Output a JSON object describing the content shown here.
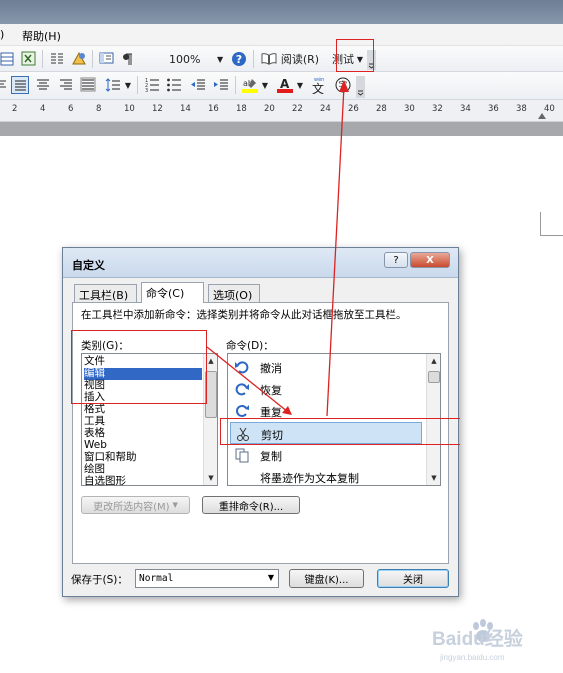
{
  "menu": {
    "paren": ")",
    "help": "帮助(H)"
  },
  "toolbar1": {
    "zoom": "100%",
    "read": "阅读(R)",
    "custom_button": "测试"
  },
  "ruler": [
    "2",
    "4",
    "6",
    "8",
    "10",
    "12",
    "14",
    "16",
    "18",
    "20",
    "22",
    "24",
    "26",
    "28",
    "30",
    "32",
    "34",
    "36",
    "38",
    "40"
  ],
  "dialog": {
    "title": "自定义",
    "help_glyph": "?",
    "close_glyph": "X",
    "tabs": [
      "工具栏(B)",
      "命令(C)",
      "选项(O)"
    ],
    "instruction": "在工具栏中添加新命令：选择类别并将命令从此对话框拖放至工具栏。",
    "categories_label": "类别(G)：",
    "categories": [
      "文件",
      "编辑",
      "视图",
      "插入",
      "格式",
      "工具",
      "表格",
      "Web",
      "窗口和帮助",
      "绘图",
      "自选图形"
    ],
    "selected_category": "编辑",
    "commands_label": "命令(D)：",
    "commands": [
      "撤消",
      "恢复",
      "重复",
      "剪切",
      "复制",
      "将墨迹作为文本复制"
    ],
    "selected_command": "剪切",
    "modify_selection": "更改所选内容(M)",
    "rearrange": "重排命令(R)...",
    "save_in_label": "保存于(S)：",
    "save_in_value": "Normal",
    "keyboard": "键盘(K)...",
    "close": "关闭"
  },
  "watermark": {
    "brand": "Baidu经验",
    "url": "jingyan.baidu.com"
  },
  "colors": {
    "annotation": "#dd2222",
    "selection": "#cfe3f7",
    "title_bar": "#c9d9ec"
  }
}
